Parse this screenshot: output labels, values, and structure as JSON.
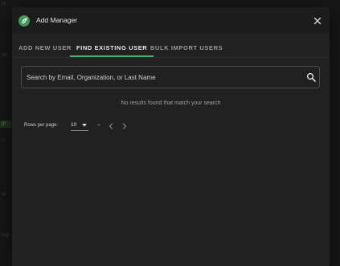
{
  "backdrop": {
    "fragments": [
      "ro",
      "Ve",
      "gr",
      "n",
      "ar",
      "ingl"
    ]
  },
  "dialog": {
    "title": "Add Manager",
    "logo_icon": "leaf-logo-icon",
    "close_icon": "close-icon"
  },
  "tabs": [
    {
      "label": "ADD NEW USER",
      "active": false
    },
    {
      "label": "FIND EXISTING USER",
      "active": true
    },
    {
      "label": "BULK IMPORT USERS",
      "active": false
    }
  ],
  "search": {
    "placeholder": "Search by Email, Organization, or Last Name",
    "value": "",
    "icon": "search-icon"
  },
  "results": {
    "empty_message": "No results found that match your search"
  },
  "pagination": {
    "rows_per_page_label": "Rows per page:",
    "rows_per_page_value": "10",
    "range_text": "–"
  },
  "colors": {
    "accent": "#4caf6a",
    "dialog_bg": "#212121",
    "header_bg": "#1c1c1c"
  }
}
